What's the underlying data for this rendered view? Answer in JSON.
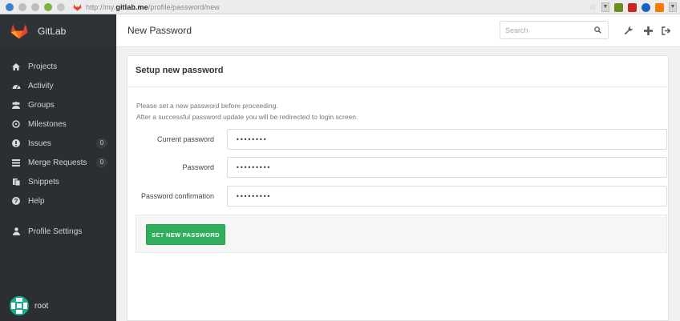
{
  "browser": {
    "url_prefix": "http://my.",
    "url_host": "gitlab.me",
    "url_path": "/profile/password/new"
  },
  "brand": {
    "name": "GitLab",
    "logo": "gitlab-fox-icon",
    "logo_color": "#e2432a"
  },
  "sidebar": {
    "items": [
      {
        "label": "Projects",
        "icon": "home-icon"
      },
      {
        "label": "Activity",
        "icon": "dashboard-icon"
      },
      {
        "label": "Groups",
        "icon": "group-icon"
      },
      {
        "label": "Milestones",
        "icon": "clock-icon"
      },
      {
        "label": "Issues",
        "icon": "exclamation-circle-icon",
        "count": "0"
      },
      {
        "label": "Merge Requests",
        "icon": "tasks-icon",
        "count": "0"
      },
      {
        "label": "Snippets",
        "icon": "clipboard-icon"
      },
      {
        "label": "Help",
        "icon": "question-circle-icon"
      }
    ],
    "profile": {
      "label": "Profile Settings",
      "icon": "user-icon"
    },
    "user": {
      "name": "root"
    }
  },
  "header": {
    "title": "New Password",
    "search_placeholder": "Search"
  },
  "panel": {
    "heading": "Setup new password",
    "notice_line1": "Please set a new password before proceeding.",
    "notice_line2": "After a successful password update you will be redirected to login screen.",
    "fields": {
      "current_label": "Current password",
      "current_value": "••••••••",
      "password_label": "Password",
      "password_value": "•••••••••",
      "confirm_label": "Password confirmation",
      "confirm_value": "•••••••••"
    },
    "submit_label": "SET NEW PASSWORD"
  },
  "colors": {
    "sidebar_bg": "#2b2e33",
    "submit_bg": "#2fae5c",
    "avatar": "#1aab8b"
  }
}
